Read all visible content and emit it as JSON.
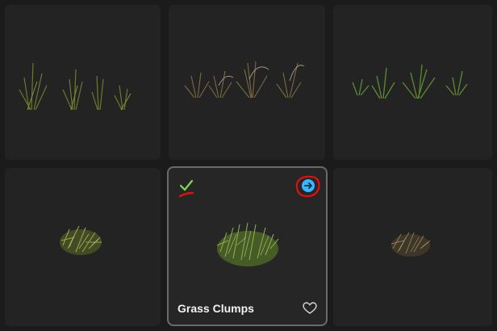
{
  "cards": [
    {
      "id": "grass-row-1"
    },
    {
      "id": "grass-row-2"
    },
    {
      "id": "grass-row-3"
    },
    {
      "id": "grass-bush-1"
    },
    {
      "id": "grass-clumps",
      "title": "Grass Clumps",
      "selected": true,
      "favorite": false
    },
    {
      "id": "grass-bush-dry"
    }
  ],
  "icons": {
    "check": "check-icon",
    "open": "arrow-right-circle-icon",
    "favorite": "heart-icon"
  },
  "colors": {
    "background": "#1b1b1b",
    "card": "#232323",
    "selected_border": "#6a6a6a",
    "check": "#7ed957",
    "accent_blue": "#38b6ff",
    "annotation_red": "#e01010"
  }
}
